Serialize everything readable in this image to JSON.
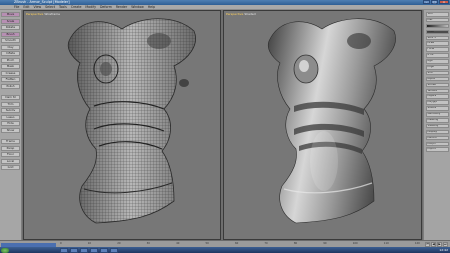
{
  "window": {
    "title": "ZBrush - Armor_Sculpt [Modeler]"
  },
  "menubar": {
    "items": [
      "File",
      "Edit",
      "View",
      "Select",
      "Tools",
      "Create",
      "Modify",
      "Deform",
      "Render",
      "Window",
      "Help"
    ]
  },
  "left_toolbar": {
    "buttons": [
      "Move",
      "Scale",
      "Rotate",
      "Brush",
      "Smooth",
      "Clay",
      "Inflate",
      "Pinch",
      "Mask",
      "Crease",
      "Flatten",
      "Polish",
      "Dam St",
      "Trim",
      "Subdiv",
      "Lasso",
      "Hide",
      "Show",
      "Frame",
      "Persp",
      "Floor",
      "Local",
      "Grid"
    ]
  },
  "viewports": {
    "left": {
      "label": "Perspective",
      "mode": "Wireframe"
    },
    "right": {
      "label": "Perspective",
      "mode": "Shaded"
    }
  },
  "right_panel": {
    "rows": [
      "Tool",
      "Mat",
      "",
      "Color",
      "SDiv 5",
      "Draw",
      "Focal",
      "Z Int",
      "Rgb",
      "Mrgb",
      "Smt",
      "Alpha",
      "Stroke",
      "Texture",
      "Layers",
      "Polygrp",
      "Subdiv",
      "Geometry",
      "Masking",
      "Visibility",
      "Display",
      "Deform",
      "Morph",
      "Export"
    ]
  },
  "timeline": {
    "ticks": [
      "0",
      "10",
      "20",
      "30",
      "40",
      "50",
      "60",
      "70",
      "80",
      "90",
      "100",
      "110",
      "120"
    ],
    "controls": [
      "⏮",
      "◀",
      "▶",
      "⏭"
    ]
  },
  "taskbar": {
    "tasks": [
      "",
      "",
      "",
      "",
      "",
      ""
    ],
    "clock": "12:42"
  },
  "colors": {
    "viewport_bg": "#777777",
    "mesh_light": "#c9c9c9",
    "mesh_dark": "#3c3c3c"
  }
}
